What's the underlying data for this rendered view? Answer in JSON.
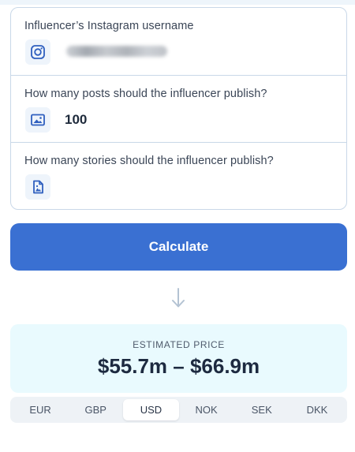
{
  "form": {
    "fields": [
      {
        "label": "Influencer’s Instagram username",
        "value": ""
      },
      {
        "label": "How many posts should the influencer publish?",
        "value": "100"
      },
      {
        "label": "How many stories should the influencer publish?",
        "value": ""
      }
    ]
  },
  "calculate_label": "Calculate",
  "estimate": {
    "label": "ESTIMATED PRICE",
    "value": "$55.7m – $66.9m"
  },
  "currencies": [
    "EUR",
    "GBP",
    "USD",
    "NOK",
    "SEK",
    "DKK"
  ],
  "selected_currency": "USD",
  "colors": {
    "accent": "#3a70d2",
    "icon": "#2f5fbf",
    "estimate_bg": "#e9fafe",
    "border": "#c9d8e8"
  },
  "icons": {
    "username": "instagram-icon",
    "posts": "image-icon",
    "stories": "story-file-icon",
    "result": "arrow-down-icon"
  }
}
